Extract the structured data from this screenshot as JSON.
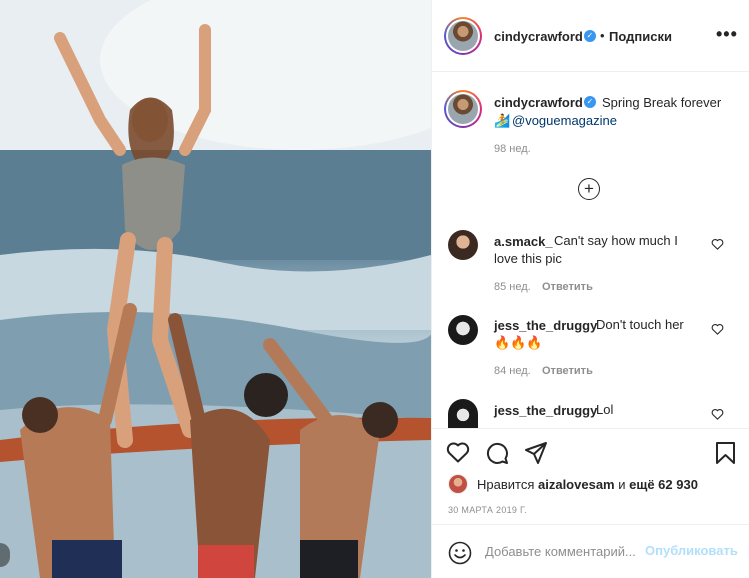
{
  "post": {
    "author": "cindycrawford",
    "follow_label": "Подписки",
    "separator": "•",
    "more_label": "•••",
    "caption": {
      "username": "cindycrawford",
      "text": "Spring Break forever",
      "emoji": "🏄",
      "mention": "@voguemagazine",
      "age": "98 нед."
    },
    "load_more": "+"
  },
  "comments": [
    {
      "username": "a.smack_",
      "text_line1": "Can't say how much I",
      "text_line2": "love this pic",
      "age": "85 нед.",
      "reply": "Ответить"
    },
    {
      "username": "jess_the_druggy",
      "text_line1": "Don't touch her",
      "text_line2": "🔥🔥🔥",
      "age": "84 нед.",
      "reply": "Ответить"
    },
    {
      "username": "jess_the_druggy",
      "text_line1": "Lol"
    }
  ],
  "footer": {
    "likes_prefix": "Нравится",
    "likes_user": "aizalovesam",
    "likes_middle": "и",
    "likes_count": "ещё 62 930",
    "date": "30 МАРТА 2019 Г.",
    "comment_placeholder": "Добавьте комментарий...",
    "publish_label": "Опубликовать"
  },
  "colors": {
    "verified": "#3897f0",
    "link": "#00376b",
    "muted": "#8e8e8e",
    "publish_disabled": "#b2dffc"
  }
}
